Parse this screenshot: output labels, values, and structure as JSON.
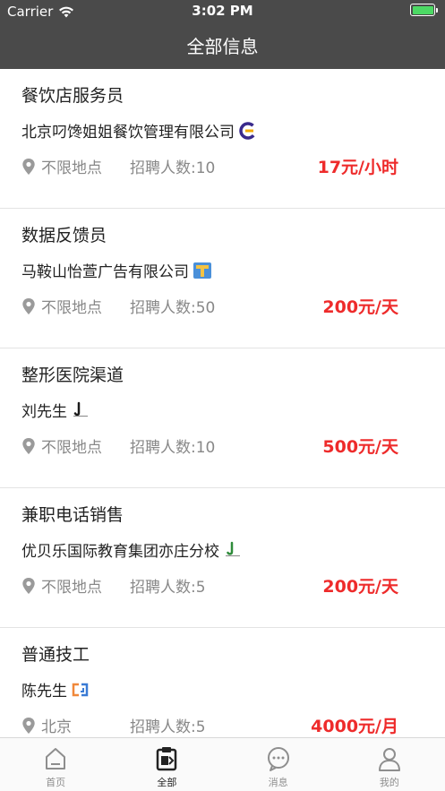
{
  "status_bar": {
    "carrier": "Carrier",
    "time": "3:02 PM"
  },
  "nav": {
    "title": "全部信息"
  },
  "jobs": [
    {
      "title": "餐饮店服务员",
      "company": "北京叼馋姐姐餐饮管理有限公司",
      "logo_icon": "brand-c-logo-icon",
      "location": "不限地点",
      "count": "招聘人数:10",
      "pay": "17元/小时"
    },
    {
      "title": "数据反馈员",
      "company": "马鞍山怡萱广告有限公司",
      "logo_icon": "brand-box-logo-icon",
      "location": "不限地点",
      "count": "招聘人数:50",
      "pay": "200元/天"
    },
    {
      "title": "整形医院渠道",
      "company": "刘先生",
      "logo_icon": "brand-j-logo-icon",
      "location": "不限地点",
      "count": "招聘人数:10",
      "pay": "500元/天"
    },
    {
      "title": "兼职电话销售",
      "company": "优贝乐国际教育集团亦庄分校",
      "logo_icon": "brand-j-green-logo-icon",
      "location": "不限地点",
      "count": "招聘人数:5",
      "pay": "200元/天"
    },
    {
      "title": "普通技工",
      "company": "陈先生",
      "logo_icon": "brand-cj-logo-icon",
      "location": "北京",
      "count": "招聘人数:5",
      "pay": "4000元/月"
    }
  ],
  "tabs": [
    {
      "label": "首页",
      "icon": "home-icon",
      "active": false
    },
    {
      "label": "全部",
      "icon": "clipboard-icon",
      "active": true
    },
    {
      "label": "消息",
      "icon": "message-icon",
      "active": false
    },
    {
      "label": "我的",
      "icon": "person-icon",
      "active": false
    }
  ],
  "colors": {
    "header_bg": "#4a4a4a",
    "pay": "#ee2b2b",
    "battery": "#4cd964"
  }
}
